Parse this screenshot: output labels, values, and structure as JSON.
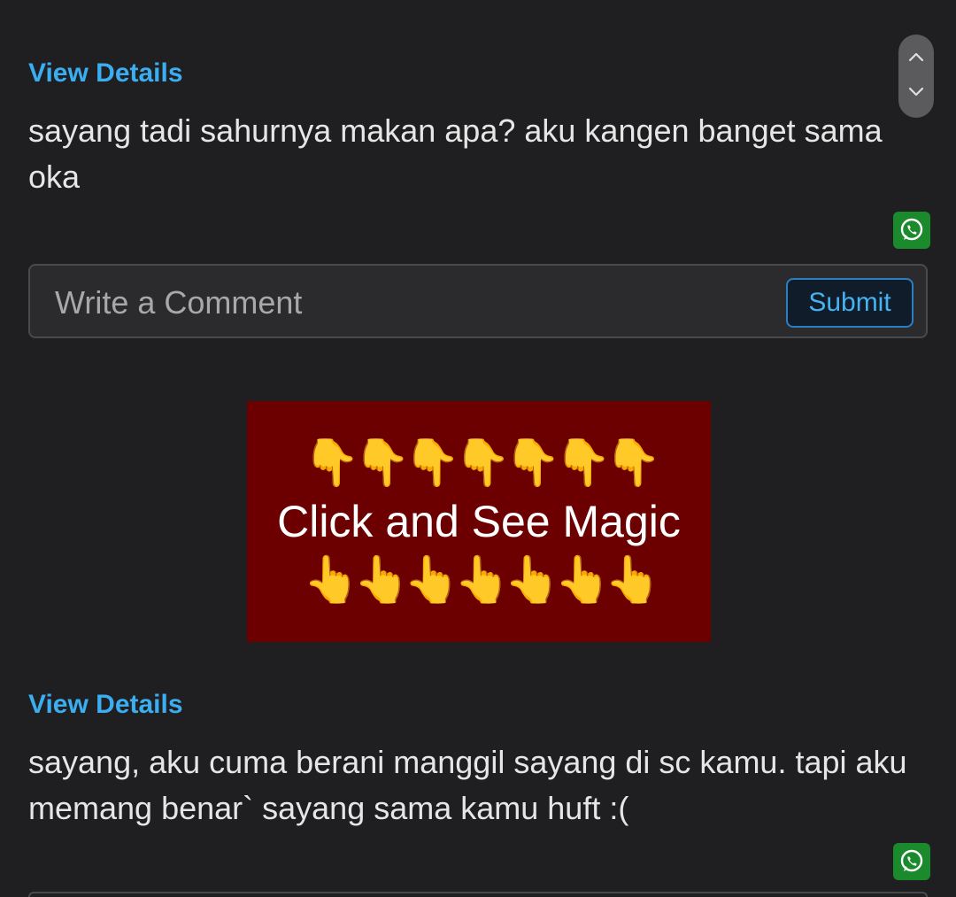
{
  "posts": [
    {
      "view_details": "View Details",
      "message": "sayang tadi sahurnya makan apa? aku kangen banget sama oka",
      "share_icon": "whatsapp-icon"
    },
    {
      "view_details": "View Details",
      "message": "sayang, aku cuma berani manggil sayang di sc kamu. tapi aku memang benar` sayang sama kamu huft :(",
      "share_icon": "whatsapp-icon"
    }
  ],
  "comment": {
    "placeholder": "Write a Comment",
    "submit_label": "Submit"
  },
  "banner": {
    "hands_top": "👇👇👇👇👇👇👇",
    "text": "Click and See Magic",
    "hands_bottom": "👆👆👆👆👆👆👆"
  },
  "colors": {
    "background": "#1f1f21",
    "link": "#3aaef0",
    "banner": "#6c0000",
    "whatsapp": "#1a8a2c"
  }
}
